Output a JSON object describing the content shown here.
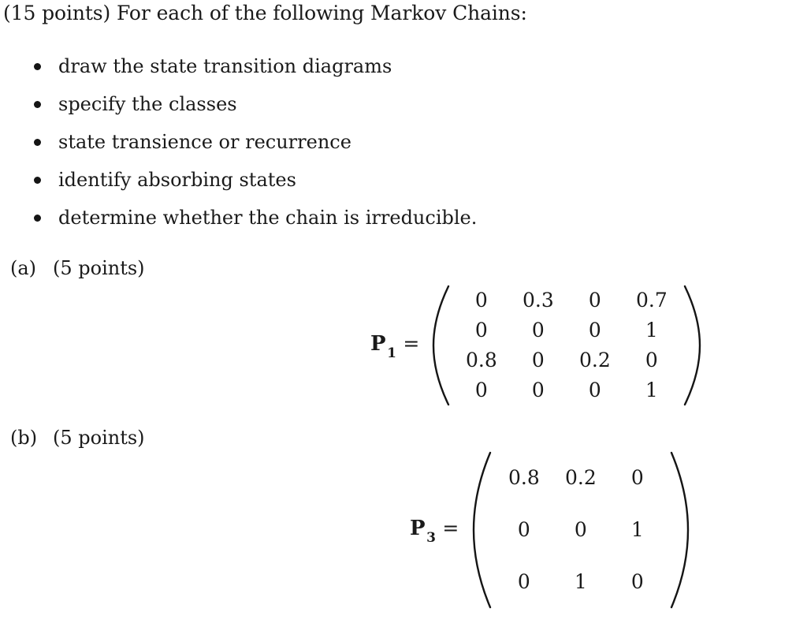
{
  "document": {
    "heading": "(15 points) For each of the following Markov Chains:",
    "tasks": [
      "draw the state transition diagrams",
      "specify the classes",
      "state transience or recurrence",
      "identify absorbing states",
      "determine whether the chain is irreducible."
    ],
    "parts": [
      {
        "tag": "(a)",
        "points": "(5 points)"
      },
      {
        "tag": "(b)",
        "points": "(5 points)"
      }
    ],
    "matrices": [
      {
        "symbol": "P",
        "subscript": "1",
        "relation": "=",
        "rows": [
          [
            "0",
            "0.3",
            "0",
            "0.7"
          ],
          [
            "0",
            "0",
            "0",
            "1"
          ],
          [
            "0.8",
            "0",
            "0.2",
            "0"
          ],
          [
            "0",
            "0",
            "0",
            "1"
          ]
        ]
      },
      {
        "symbol": "P",
        "subscript": "3",
        "relation": "=",
        "rows": [
          [
            "0.8",
            "0.2",
            "0"
          ],
          [
            "0",
            "0",
            "1"
          ],
          [
            "0",
            "1",
            "0"
          ]
        ]
      }
    ]
  },
  "colors": {
    "background": "#ffffff",
    "text": "#1a1a1a"
  }
}
